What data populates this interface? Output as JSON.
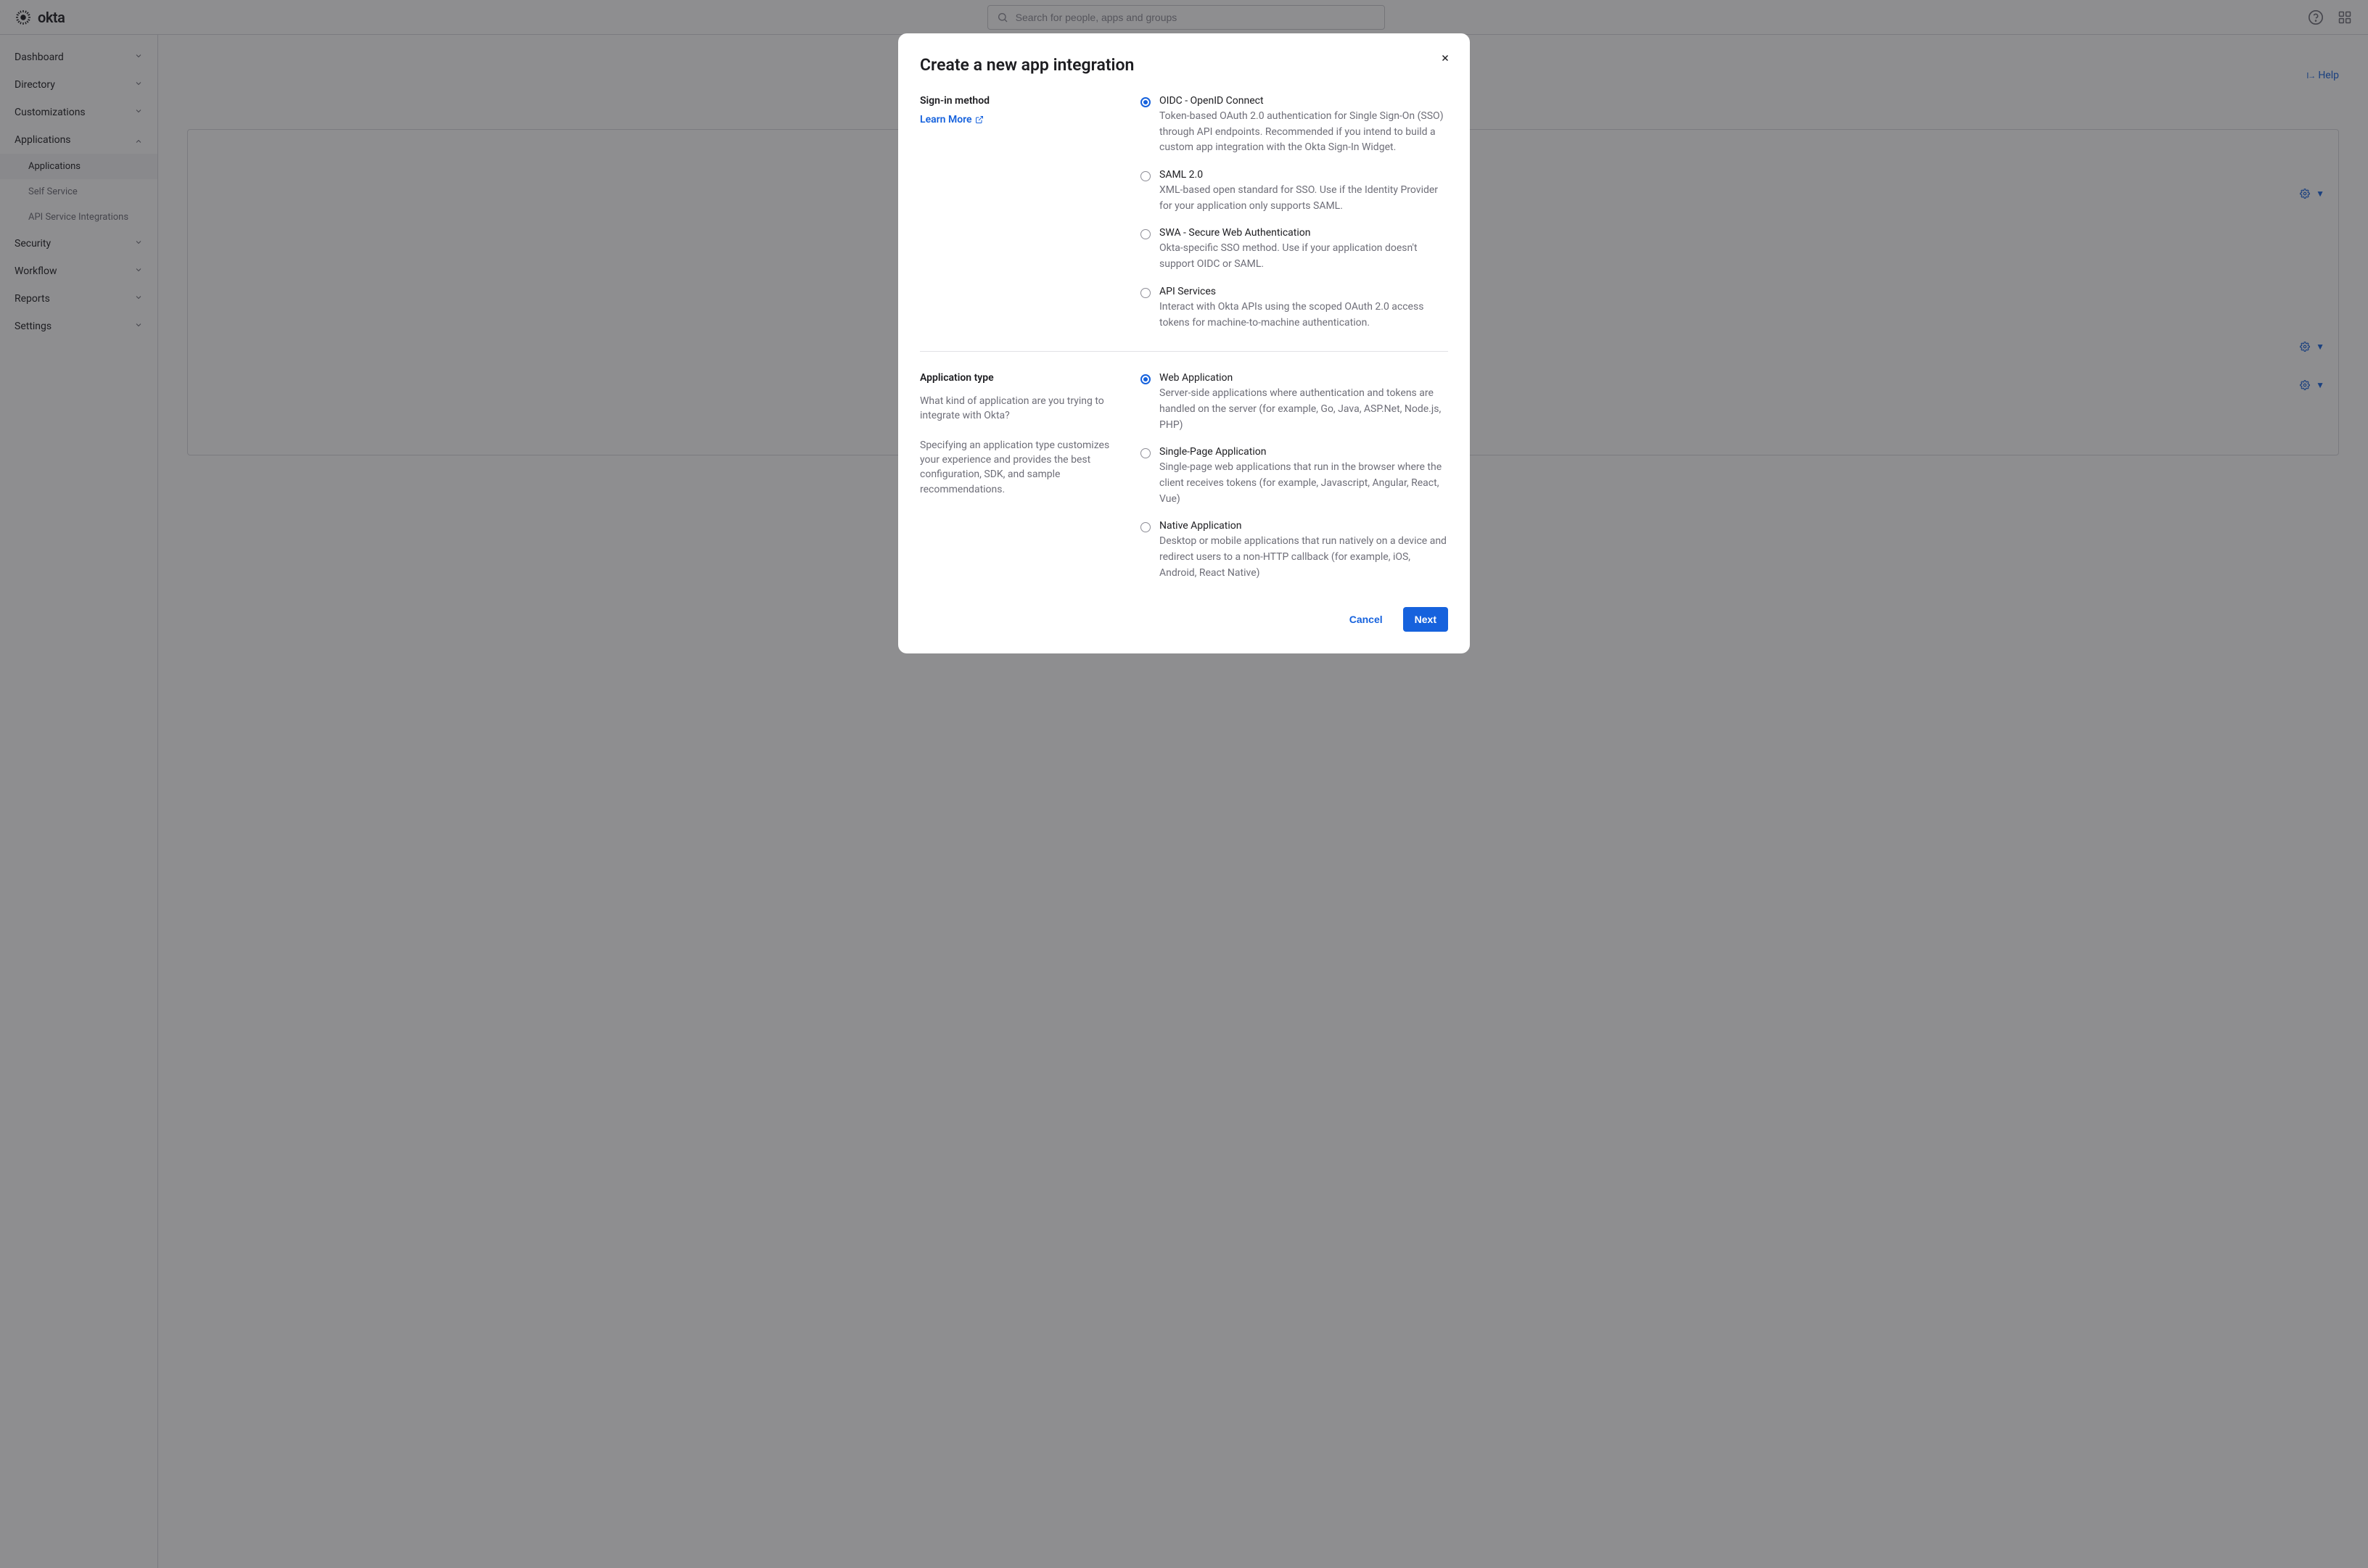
{
  "header": {
    "logo_text": "okta",
    "search_placeholder": "Search for people, apps and groups"
  },
  "sidebar": {
    "items": [
      {
        "label": "Dashboard",
        "expanded": false
      },
      {
        "label": "Directory",
        "expanded": false
      },
      {
        "label": "Customizations",
        "expanded": false
      },
      {
        "label": "Applications",
        "expanded": true,
        "children": [
          {
            "label": "Applications",
            "active": true
          },
          {
            "label": "Self Service",
            "active": false
          },
          {
            "label": "API Service Integrations",
            "active": false
          }
        ]
      },
      {
        "label": "Security",
        "expanded": false
      },
      {
        "label": "Workflow",
        "expanded": false
      },
      {
        "label": "Reports",
        "expanded": false
      },
      {
        "label": "Settings",
        "expanded": false
      }
    ]
  },
  "content": {
    "help_label": "Help"
  },
  "modal": {
    "title": "Create a new app integration",
    "signin": {
      "label": "Sign-in method",
      "learn_more": "Learn More",
      "options": [
        {
          "title": "OIDC - OpenID Connect",
          "desc": "Token-based OAuth 2.0 authentication for Single Sign-On (SSO) through API endpoints. Recommended if you intend to build a custom app integration with the Okta Sign-In Widget.",
          "selected": true
        },
        {
          "title": "SAML 2.0",
          "desc": "XML-based open standard for SSO. Use if the Identity Provider for your application only supports SAML.",
          "selected": false
        },
        {
          "title": "SWA - Secure Web Authentication",
          "desc": "Okta-specific SSO method. Use if your application doesn't support OIDC or SAML.",
          "selected": false
        },
        {
          "title": "API Services",
          "desc": "Interact with Okta APIs using the scoped OAuth 2.0 access tokens for machine-to-machine authentication.",
          "selected": false
        }
      ]
    },
    "apptype": {
      "label": "Application type",
      "helper1": "What kind of application are you trying to integrate with Okta?",
      "helper2": "Specifying an application type customizes your experience and provides the best configuration, SDK, and sample recommendations.",
      "options": [
        {
          "title": "Web Application",
          "desc": "Server-side applications where authentication and tokens are handled on the server (for example, Go, Java, ASP.Net, Node.js, PHP)",
          "selected": true
        },
        {
          "title": "Single-Page Application",
          "desc": "Single-page web applications that run in the browser where the client receives tokens (for example, Javascript, Angular, React, Vue)",
          "selected": false
        },
        {
          "title": "Native Application",
          "desc": "Desktop or mobile applications that run natively on a device and redirect users to a non-HTTP callback (for example, iOS, Android, React Native)",
          "selected": false
        }
      ]
    },
    "cancel_label": "Cancel",
    "next_label": "Next"
  }
}
